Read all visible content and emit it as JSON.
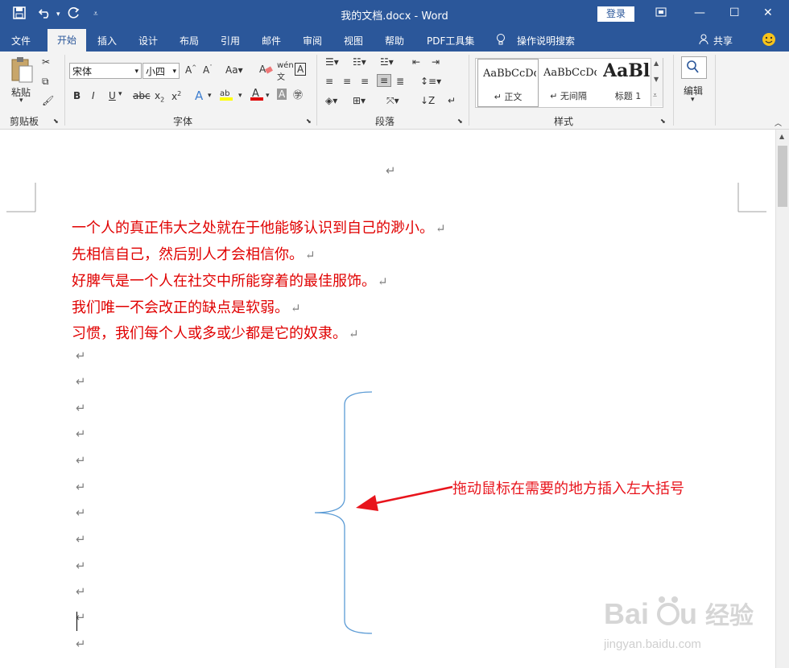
{
  "titlebar": {
    "title": "我的文档.docx  -  Word",
    "login_label": "登录",
    "save_icon": "save-icon",
    "undo_icon": "undo-icon",
    "redo_icon": "redo-icon"
  },
  "tabs": {
    "file": "文件",
    "home": "开始",
    "insert": "插入",
    "design": "设计",
    "layout": "布局",
    "references": "引用",
    "mailings": "邮件",
    "review": "审阅",
    "view": "视图",
    "help": "帮助",
    "pdf": "PDF工具集",
    "search": "操作说明搜索",
    "share": "共享"
  },
  "ribbon": {
    "paste_label": "粘贴",
    "clipboard_label": "剪贴板",
    "font_name": "宋体",
    "font_size": "小四",
    "font_group_label": "字体",
    "paragraph_group_label": "段落",
    "styles_group_label": "样式",
    "editing_label": "编辑",
    "styles": [
      {
        "sample": "AaBbCcDd",
        "name": "↵ 正文"
      },
      {
        "sample": "AaBbCcDd",
        "name": "↵ 无间隔"
      },
      {
        "sample": "AaBl",
        "name": "标题 1"
      }
    ]
  },
  "document": {
    "lines": [
      "一个人的真正伟大之处就在于他能够认识到自己的渺小。",
      "先相信自己，然后别人才会相信你。",
      "好脾气是一个人在社交中所能穿着的最佳服饰。",
      "我们唯一不会改正的缺点是软弱。",
      "习惯，我们每个人或多或少都是它的奴隶。"
    ],
    "paragraph_mark": "↵"
  },
  "annotation": {
    "text": "拖动鼠标在需要的地方插入左大括号"
  },
  "watermark": {
    "brand": "Baidu经验",
    "url": "jingyan.baidu.com"
  }
}
